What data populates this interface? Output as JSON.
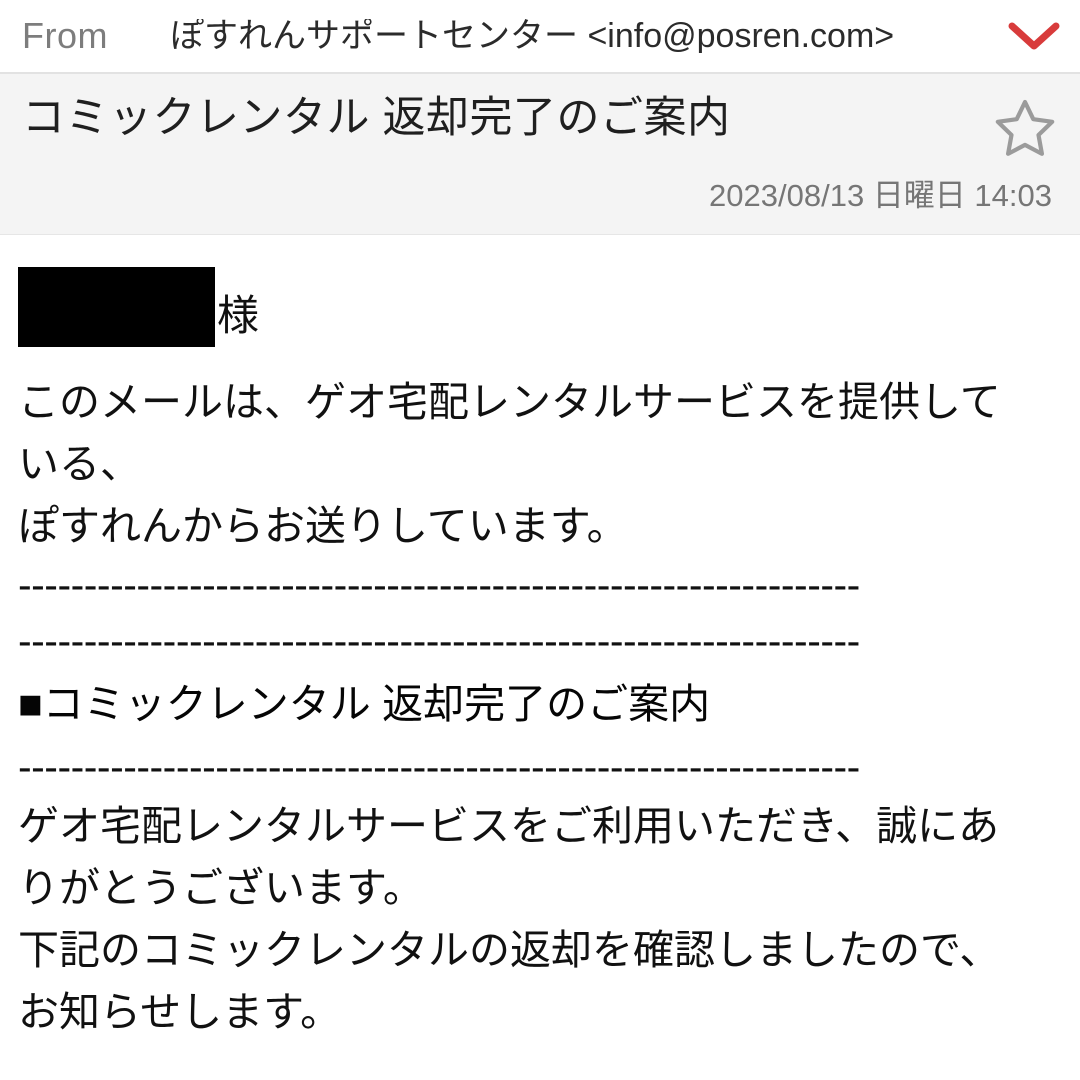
{
  "header": {
    "from_label": "From",
    "from_value": "ぽすれんサポートセンター <info@posren.com>",
    "expand_icon": "chevron-down-icon",
    "expand_icon_color": "#d83b3b"
  },
  "subject": {
    "title": "コミックレンタル 返却完了のご案内",
    "star_icon": "star-outline-icon",
    "star_icon_color": "#9b9b9b",
    "date": "2023/08/13 日曜日 14:03"
  },
  "body": {
    "recipient_redacted": "",
    "honorific": "様",
    "lines": [
      "このメールは、ゲオ宅配レンタルサービスを提供して",
      "いる、",
      "ぽすれんからお送りしています。"
    ],
    "divider1": "----------------------------------------------------------------",
    "divider2": "----------------------------------------------------------------",
    "heading": "■コミックレンタル 返却完了のご案内",
    "divider3": "----------------------------------------------------------------",
    "lines2": [
      "ゲオ宅配レンタルサービスをご利用いただき、誠にあ",
      "りがとうございます。",
      "下記のコミックレンタルの返却を確認しましたので、",
      "お知らせします。"
    ]
  },
  "colors": {
    "page_background": "#ffffff",
    "subject_background": "#f4f4f4",
    "text_primary": "#111111",
    "text_muted": "#767676",
    "accent_red": "#d83b3b",
    "redaction": "#000000"
  }
}
